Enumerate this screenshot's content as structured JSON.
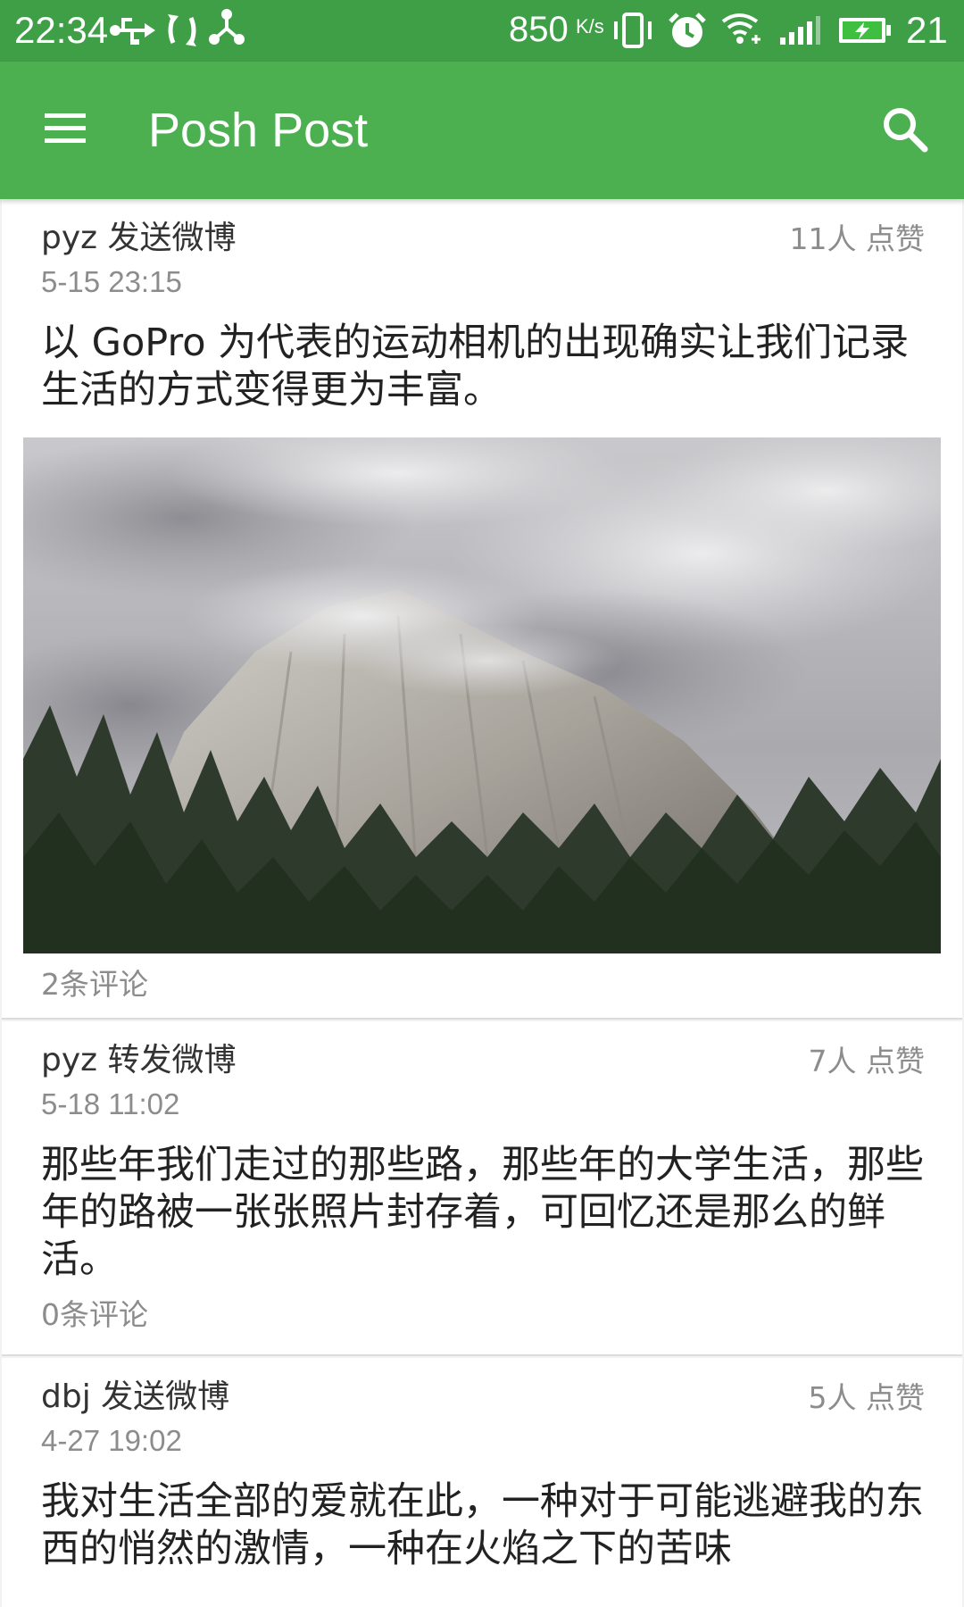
{
  "status_bar": {
    "time": "22:34",
    "net_speed": "850",
    "net_speed_unit": "K/s",
    "battery": "21",
    "icons": [
      "usb-icon",
      "sync-icon",
      "share-icon",
      "vibrate-icon",
      "alarm-icon",
      "wifi-icon",
      "signal-icon",
      "battery-charging-icon"
    ]
  },
  "app_bar": {
    "title": "Posh Post",
    "menu_icon": "menu-icon",
    "search_icon": "search-icon",
    "color": "#4caf50",
    "status_color": "#3f9f47"
  },
  "posts": [
    {
      "author_action": "pyz 发送微博",
      "time": "5-15 23:15",
      "likes": "11人 点赞",
      "text": "以 GoPro 为代表的运动相机的出现确实让我们记录生活的方式变得更为丰富。",
      "has_image": true,
      "comments": "2条评论"
    },
    {
      "author_action": "pyz 转发微博",
      "time": "5-18 11:02",
      "likes": "7人 点赞",
      "text": "那些年我们走过的那些路，那些年的大学生活，那些年的路被一张张照片封存着，可回忆还是那么的鲜活。",
      "has_image": false,
      "comments": "0条评论"
    },
    {
      "author_action": "dbj 发送微博",
      "time": "4-27 19:02",
      "likes": "5人 点赞",
      "text": "我对生活全部的爱就在此，一种对于可能逃避我的东西的悄然的激情，一种在火焰之下的苦味",
      "has_image": false,
      "comments": ""
    }
  ]
}
